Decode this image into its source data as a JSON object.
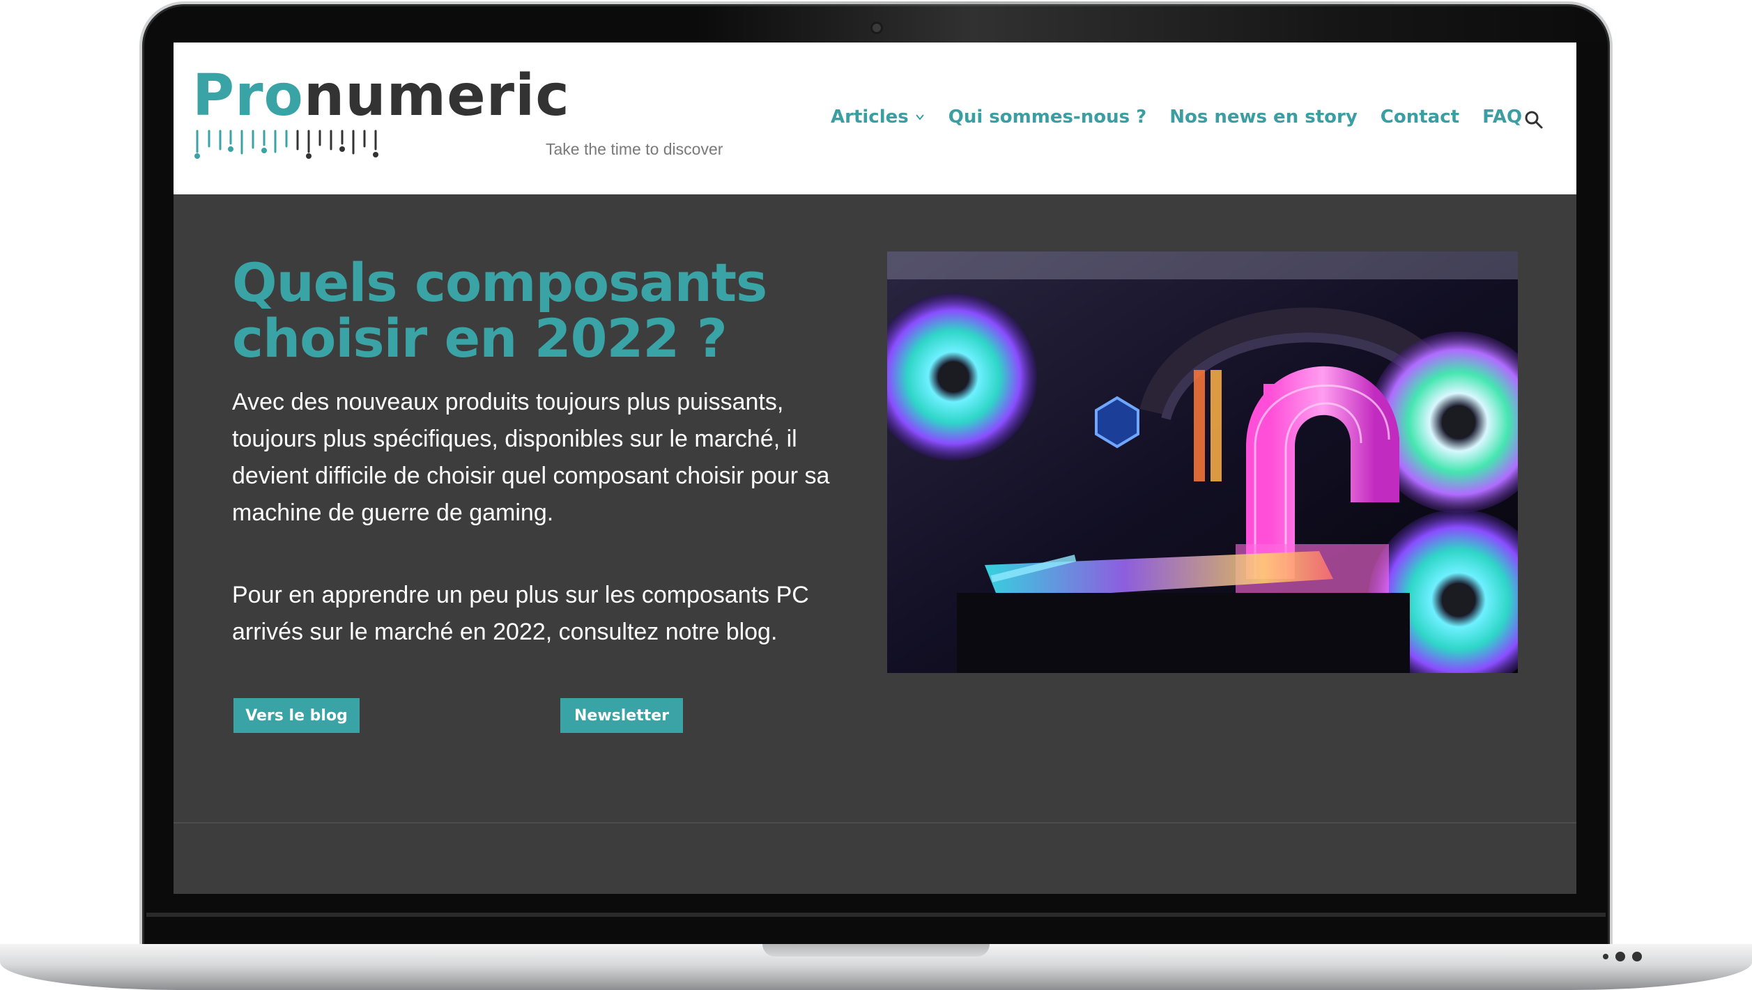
{
  "site": {
    "logo_part1": "Pro",
    "logo_part2": "numeric",
    "tagline": "Take the time to discover"
  },
  "nav": {
    "items": [
      {
        "label": "Articles",
        "has_dropdown": true
      },
      {
        "label": "Qui sommes-nous ?"
      },
      {
        "label": "Nos news en story"
      },
      {
        "label": "Contact"
      },
      {
        "label": "FAQ"
      }
    ],
    "search_icon": "search-icon"
  },
  "hero": {
    "title": "Quels composants choisir en 2022 ?",
    "paragraph1": "Avec des nouveaux produits toujours plus puissants, toujours plus spécifiques, disponibles sur le marché,  il devient difficile de choisir quel composant choisir pour sa machine de guerre de gaming.",
    "paragraph2": "Pour en apprendre un peu plus sur les composants PC arrivés sur le marché en 2022, consultez notre blog.",
    "button_blog": "Vers le blog",
    "button_newsletter": "Newsletter"
  },
  "colors": {
    "accent": "#3aa3a5",
    "nav_text": "#3a9ea2",
    "hero_background": "#3d3d3d",
    "header_background": "#ffffff"
  }
}
